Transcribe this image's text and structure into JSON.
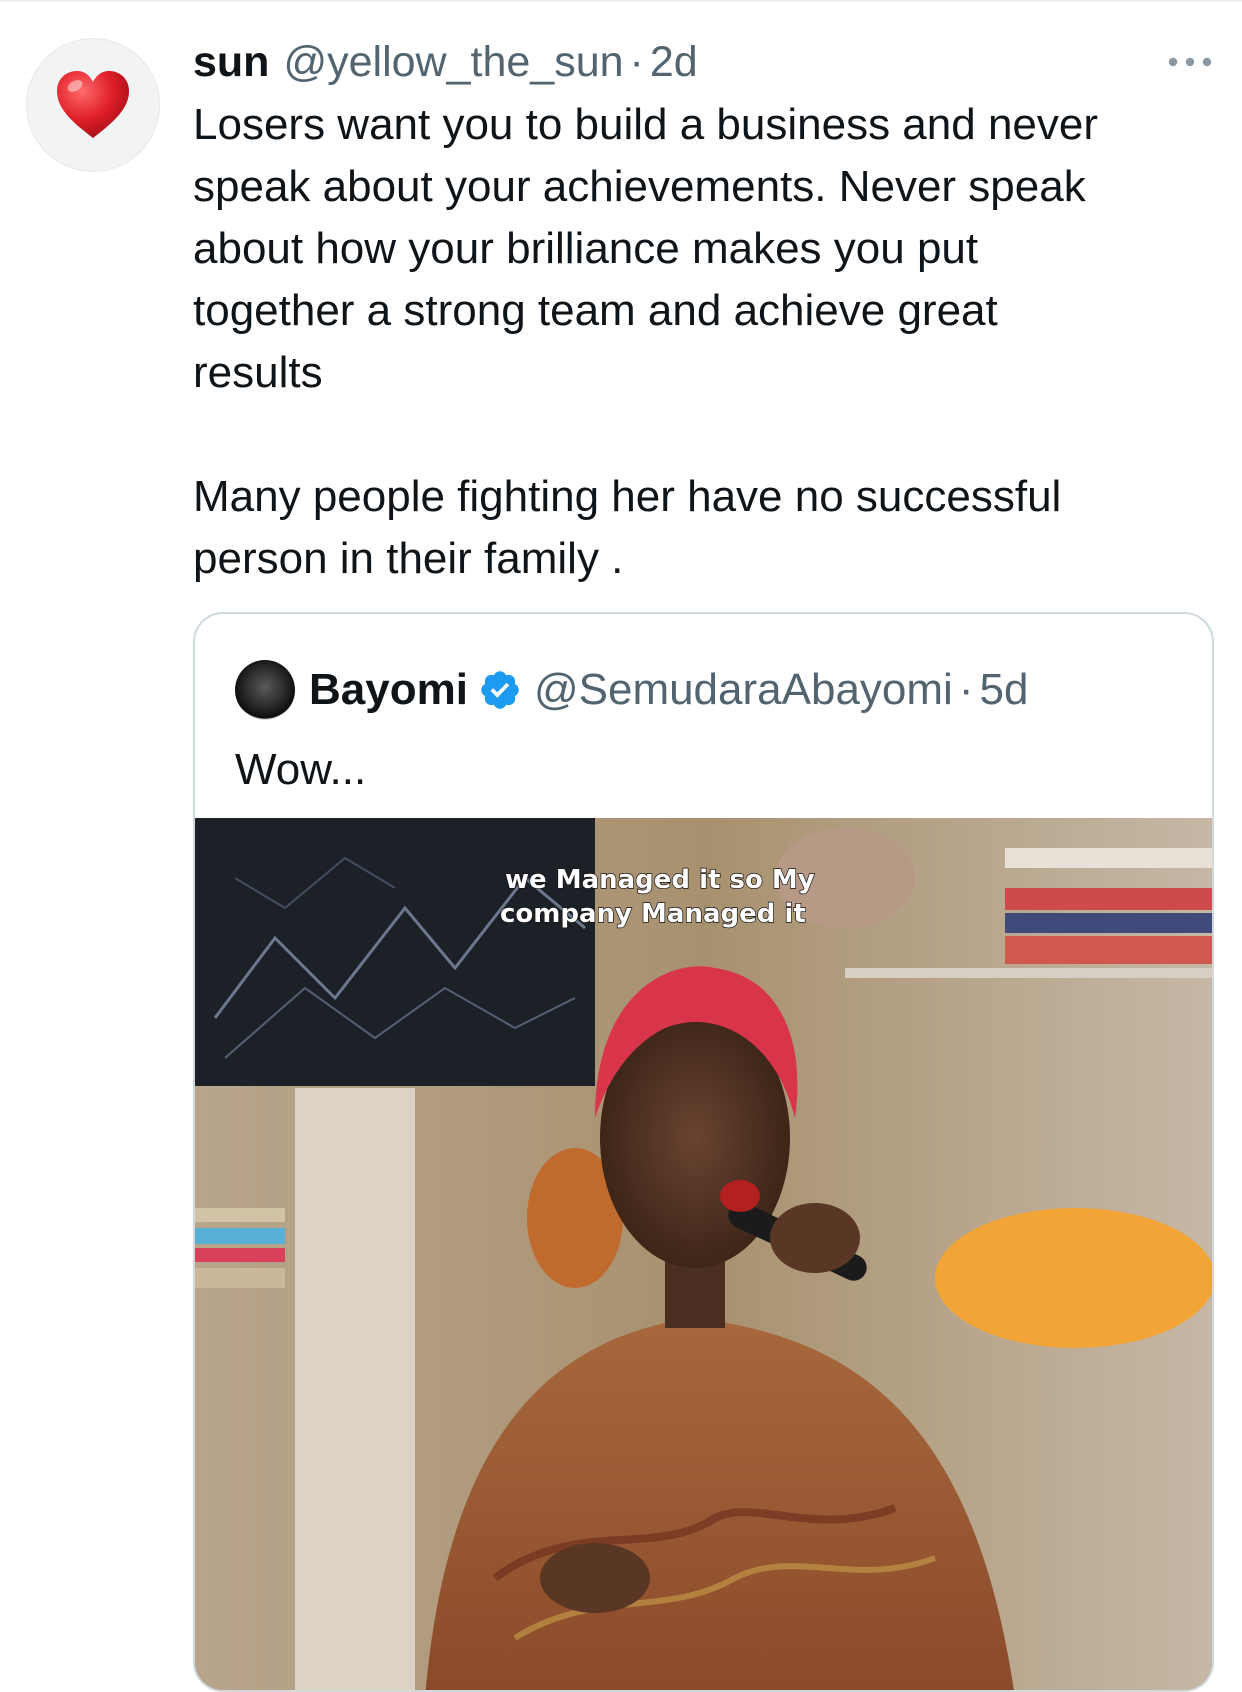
{
  "tweet": {
    "display_name": "sun",
    "handle": "@yellow_the_sun",
    "separator": "·",
    "time": "2d",
    "avatar_icon": "red-heart-emoji",
    "more_icon": "more-dots-icon",
    "text": "Losers want you to build a business and never\nspeak about your achievements. Never speak\nabout how your brilliance makes you put\ntogether a strong team and achieve great\nresults\n\nMany people fighting her have no successful\nperson in their family ."
  },
  "quote": {
    "display_name": "Bayomi",
    "verified_icon": "verified-badge-icon",
    "verified_color": "#1d9bf0",
    "handle": "@SemudaraAbayomi",
    "separator": "·",
    "time": "5d",
    "text": "Wow...",
    "media": {
      "caption_line1": "we Managed it so My",
      "caption_line2": "company Managed it"
    }
  },
  "colors": {
    "primary_text": "#0f1419",
    "secondary_text": "#536471",
    "border": "#cfd9de",
    "heart": "#e0202a"
  }
}
